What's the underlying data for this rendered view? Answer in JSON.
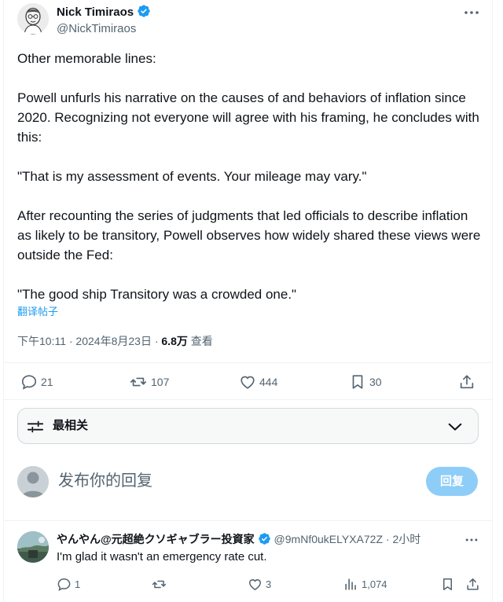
{
  "tweet": {
    "author_name": "Nick Timiraos",
    "author_handle": "@NickTimiraos",
    "paragraphs": [
      "Other memorable lines:",
      "Powell unfurls his narrative on the causes of and behaviors of inflation since 2020. Recognizing not everyone will agree with his framing, he concludes with this:",
      "\"That is my assessment of events. Your mileage may vary.\"",
      "After recounting the series of judgments that led officials to describe inflation as likely to be transitory, Powell observes how widely shared these views were outside the Fed:",
      "\"The good ship Transitory was a crowded one.\""
    ],
    "translate_label": "翻译帖子",
    "timestamp": "下午10:11 · 2024年8月23日 · ",
    "views_count": "6.8万",
    "views_label": " 查看",
    "stats": {
      "replies": "21",
      "retweets": "107",
      "likes": "444",
      "bookmarks": "30"
    }
  },
  "sort": {
    "label": "最相关"
  },
  "composer": {
    "placeholder": "发布你的回复",
    "button_label": "回复"
  },
  "reply": {
    "name": "やんやん@元超絶クソギャブラー投資家",
    "handle_time": "@9mNf0ukELYXA72Z · 2小时",
    "text": "I'm glad it wasn't an emergency rate cut.",
    "stats": {
      "replies": "1",
      "retweets": "",
      "likes": "3",
      "views": "1,074"
    }
  },
  "colors": {
    "accent": "#1d9bf0",
    "secondary_text": "#536471",
    "reply_button_disabled": "#8ecdf8"
  },
  "icons": [
    "verified-badge-icon",
    "more-icon",
    "reply-icon",
    "retweet-icon",
    "like-icon",
    "bookmark-icon",
    "share-icon",
    "sort-sliders-icon",
    "chevron-down-icon",
    "analytics-icon"
  ]
}
